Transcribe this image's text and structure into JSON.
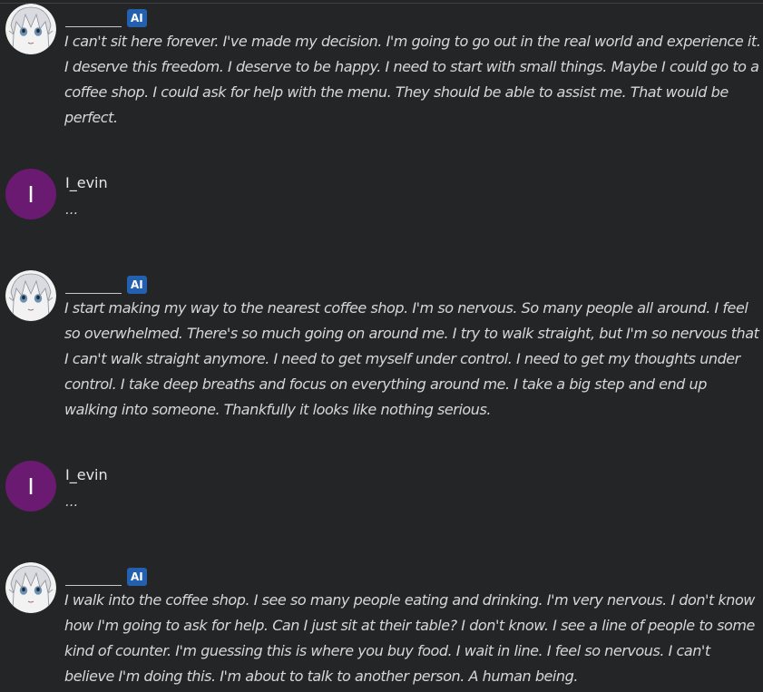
{
  "badge_label": "AI",
  "user_initial": "I",
  "messages": [
    {
      "role": "character",
      "name": "",
      "text": "I can't sit here forever. I've made my decision. I'm going to go out in the real world and experience it. I deserve this freedom. I deserve to be happy. I need to start with small things. Maybe I could go to a coffee shop. I could ask for help with the menu. They should be able to assist me. That would be perfect."
    },
    {
      "role": "user",
      "name": "I_evin",
      "text": "..."
    },
    {
      "role": "character",
      "name": "",
      "text": "I start making my way to the nearest coffee shop. I'm so nervous. So many people all around. I feel so overwhelmed. There's so much going on around me. I try to walk straight, but I'm so nervous that I can't walk straight anymore. I need to get myself under control. I need to get my thoughts under control. I take deep breaths and focus on everything around me. I take a big step and end up walking into someone. Thankfully it looks like nothing serious."
    },
    {
      "role": "user",
      "name": "I_evin",
      "text": "..."
    },
    {
      "role": "character",
      "name": "",
      "text": "I walk into the coffee shop. I see so many people eating and drinking. I'm very nervous. I don't know how I'm going to ask for help. Can I just sit at their table? I don't know. I see a line of people to some kind of counter. I'm guessing this is where you buy food. I wait in line. I feel so nervous. I can't believe I'm doing this. I'm about to talk to another person. A human being."
    }
  ],
  "colors": {
    "background": "#242526",
    "badge": "#2361b0",
    "user_avatar": "#6b1a71"
  }
}
